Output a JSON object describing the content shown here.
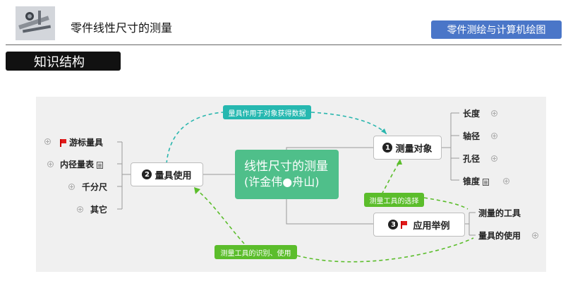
{
  "header": {
    "title": "零件线性尺寸的测量",
    "course_badge": "零件测绘与计算机绘图",
    "section_tab": "知识结构"
  },
  "colors": {
    "badge": "#4a76c8",
    "central_node": "#4fbf8a",
    "teal_tag": "#26b8b0",
    "green_tag": "#5bbd2b",
    "flag": "#e01b1b"
  },
  "mindmap": {
    "center": {
      "line1": "线性尺寸的测量",
      "line2": "(许金伟●舟山)"
    },
    "branches": {
      "measure_object": {
        "num": "1",
        "label": "测量对象",
        "children": [
          "长度",
          "轴径",
          "孔径",
          "锥度"
        ]
      },
      "tool_use": {
        "num": "2",
        "label": "量具使用",
        "children": [
          "游标量具",
          "内径量表",
          "千分尺",
          "其它"
        ]
      },
      "examples": {
        "num": "3",
        "label": "应用举例",
        "children": [
          "测量的工具",
          "量具的使用"
        ]
      }
    },
    "relations": {
      "tool_purpose": "量具作用于对象获得数据",
      "tool_choice": "测量工具的选择",
      "tool_recognition": "测量工具的识别、使用"
    }
  }
}
